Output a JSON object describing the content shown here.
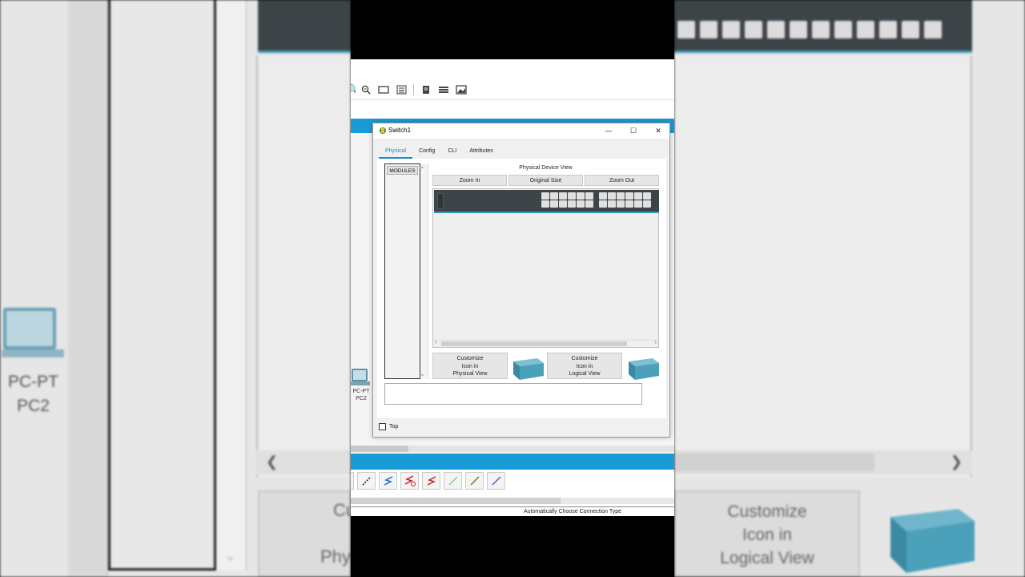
{
  "dialog": {
    "title": "Switch1",
    "tabs": [
      {
        "label": "Physical",
        "active": true
      },
      {
        "label": "Config",
        "active": false
      },
      {
        "label": "CLI",
        "active": false
      },
      {
        "label": "Attributes",
        "active": false
      }
    ],
    "modules_label": "MODULES",
    "device_view_title": "Physical Device View",
    "zoom_in": "Zoom In",
    "original_size": "Original Size",
    "zoom_out": "Zoom Out",
    "customize_physical": "Customize Icon in Physical View",
    "customize_physical_lines": [
      "Customize",
      "Icon in",
      "Physical View"
    ],
    "customize_logical_lines": [
      "Customize",
      "Icon in",
      "Logical View"
    ],
    "top_checkbox_label": "Top",
    "top_checked": false
  },
  "workspace": {
    "device_name": "PC2",
    "device_type": "PC-PT"
  },
  "status_bar": {
    "text": "Automatically Choose Connection Type"
  },
  "background_zoom": {
    "left_pc_type": "PC-PT",
    "left_pc_name": "PC2",
    "left_button_fragment_1": "Cu",
    "left_button_fragment_2": "Phy",
    "right_button_lines": [
      "Customize",
      "Icon in",
      "Logical View"
    ]
  },
  "colors": {
    "accent_blue": "#1a9ad6",
    "tab_active": "#1a8ad0",
    "switch_body": "#3d4448",
    "switch_stripe": "#3a9ab5"
  },
  "toolbar_icons": [
    "zoom-in-icon",
    "zoom-out-icon",
    "rectangle-icon",
    "list-icon",
    "document-icon",
    "layers-icon",
    "image-icon"
  ],
  "connection_icons": [
    "console-cable-icon",
    "straight-cable-icon",
    "crossover-cable-icon",
    "fiber-icon",
    "phone-cable-icon",
    "coax-cable-icon",
    "serial-cable-icon",
    "octal-cable-icon"
  ]
}
